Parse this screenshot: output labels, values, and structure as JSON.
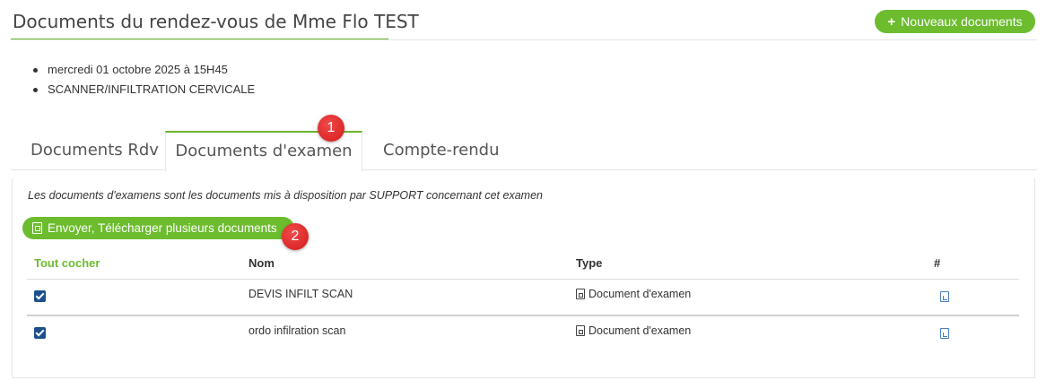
{
  "header": {
    "title": "Documents du rendez-vous de Mme Flo TEST",
    "new_button_icon": "plus-icon",
    "new_button_label": "Nouveaux documents"
  },
  "appointment": {
    "items": [
      "mercredi 01 octobre 2025 à 15H45",
      "SCANNER/INFILTRATION CERVICALE"
    ]
  },
  "tabs": [
    {
      "label": "Documents Rdv",
      "active": false
    },
    {
      "label": "Documents d'examen",
      "active": true
    },
    {
      "label": "Compte-rendu",
      "active": false
    }
  ],
  "annotations": {
    "badge_1": "1",
    "badge_2": "2"
  },
  "panel": {
    "note": "Les documents d'examens sont les documents mis à disposition par SUPPORT concernant cet examen",
    "send_button_label": "Envoyer, Télécharger plusieurs documents"
  },
  "table": {
    "headers": {
      "check_all": "Tout cocher",
      "name": "Nom",
      "type": "Type",
      "actions": "#"
    },
    "rows": [
      {
        "checked": true,
        "name": "DEVIS INFILT SCAN",
        "type": "Document d'examen",
        "action_icon": "pdf-file-icon"
      },
      {
        "checked": true,
        "name": "ordo infilration scan",
        "type": "Document d'examen",
        "action_icon": "pdf-file-icon"
      }
    ]
  },
  "colors": {
    "accent": "#6cbc2e",
    "checkbox": "#1c4f8c",
    "badge": "#d11a1a",
    "link": "#4a7fc1"
  }
}
